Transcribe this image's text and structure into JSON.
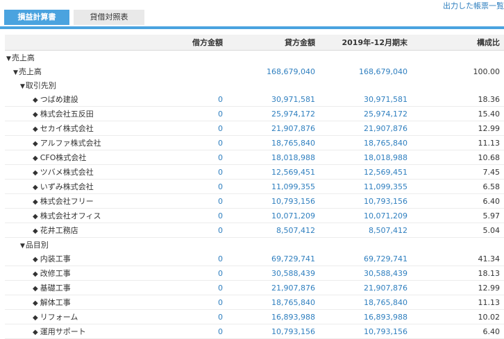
{
  "header": {
    "report_list_link": "出力した帳票一覧"
  },
  "tabs": [
    {
      "label": "損益計算書"
    },
    {
      "label": "貸借対照表"
    }
  ],
  "table": {
    "columns": [
      "",
      "借方金額",
      "貸方金額",
      "2019年-12月期末",
      "構成比"
    ],
    "rows": [
      {
        "label": "売上高",
        "kind": "group0",
        "debit": "",
        "credit": "",
        "balance": "",
        "ratio": ""
      },
      {
        "label": "売上高",
        "kind": "group1",
        "debit": "",
        "credit": "168,679,040",
        "balance": "168,679,040",
        "ratio": "100.00"
      },
      {
        "label": "取引先別",
        "kind": "group2",
        "debit": "",
        "credit": "",
        "balance": "",
        "ratio": ""
      },
      {
        "label": "つばめ建設",
        "kind": "leaf",
        "debit": "0",
        "credit": "30,971,581",
        "balance": "30,971,581",
        "ratio": "18.36"
      },
      {
        "label": "株式会社五反田",
        "kind": "leaf",
        "debit": "0",
        "credit": "25,974,172",
        "balance": "25,974,172",
        "ratio": "15.40"
      },
      {
        "label": "セカイ株式会社",
        "kind": "leaf",
        "debit": "0",
        "credit": "21,907,876",
        "balance": "21,907,876",
        "ratio": "12.99"
      },
      {
        "label": "アルファ株式会社",
        "kind": "leaf",
        "debit": "0",
        "credit": "18,765,840",
        "balance": "18,765,840",
        "ratio": "11.13"
      },
      {
        "label": "CFO株式会社",
        "kind": "leaf",
        "debit": "0",
        "credit": "18,018,988",
        "balance": "18,018,988",
        "ratio": "10.68"
      },
      {
        "label": "ツバメ株式会社",
        "kind": "leaf",
        "debit": "0",
        "credit": "12,569,451",
        "balance": "12,569,451",
        "ratio": "7.45"
      },
      {
        "label": "いずみ株式会社",
        "kind": "leaf",
        "debit": "0",
        "credit": "11,099,355",
        "balance": "11,099,355",
        "ratio": "6.58"
      },
      {
        "label": "株式会社フリー",
        "kind": "leaf",
        "debit": "0",
        "credit": "10,793,156",
        "balance": "10,793,156",
        "ratio": "6.40"
      },
      {
        "label": "株式会社オフィス",
        "kind": "leaf",
        "debit": "0",
        "credit": "10,071,209",
        "balance": "10,071,209",
        "ratio": "5.97"
      },
      {
        "label": "花井工務店",
        "kind": "leaf",
        "debit": "0",
        "credit": "8,507,412",
        "balance": "8,507,412",
        "ratio": "5.04"
      },
      {
        "label": "品目別",
        "kind": "group2",
        "debit": "",
        "credit": "",
        "balance": "",
        "ratio": ""
      },
      {
        "label": "内装工事",
        "kind": "leaf",
        "debit": "0",
        "credit": "69,729,741",
        "balance": "69,729,741",
        "ratio": "41.34"
      },
      {
        "label": "改修工事",
        "kind": "leaf",
        "debit": "0",
        "credit": "30,588,439",
        "balance": "30,588,439",
        "ratio": "18.13"
      },
      {
        "label": "基礎工事",
        "kind": "leaf",
        "debit": "0",
        "credit": "21,907,876",
        "balance": "21,907,876",
        "ratio": "12.99"
      },
      {
        "label": "解体工事",
        "kind": "leaf",
        "debit": "0",
        "credit": "18,765,840",
        "balance": "18,765,840",
        "ratio": "11.13"
      },
      {
        "label": "リフォーム",
        "kind": "leaf",
        "debit": "0",
        "credit": "16,893,988",
        "balance": "16,893,988",
        "ratio": "10.02"
      },
      {
        "label": "運用サポート",
        "kind": "leaf",
        "debit": "0",
        "credit": "10,793,156",
        "balance": "10,793,156",
        "ratio": "6.40"
      }
    ]
  }
}
